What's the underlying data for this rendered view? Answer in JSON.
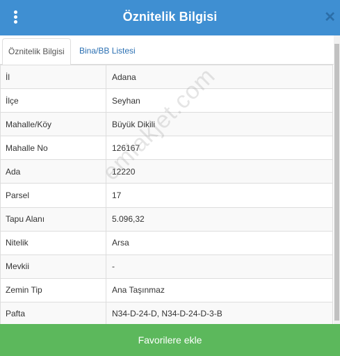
{
  "header": {
    "title": "Öznitelik Bilgisi"
  },
  "tabs": [
    {
      "label": "Öznitelik Bilgisi",
      "active": true
    },
    {
      "label": "Bina/BB Listesi",
      "active": false
    }
  ],
  "attributes": [
    {
      "key": "İl",
      "value": "Adana"
    },
    {
      "key": "İlçe",
      "value": "Seyhan"
    },
    {
      "key": "Mahalle/Köy",
      "value": "Büyük Dikili"
    },
    {
      "key": "Mahalle No",
      "value": "126167"
    },
    {
      "key": "Ada",
      "value": "12220"
    },
    {
      "key": "Parsel",
      "value": "17"
    },
    {
      "key": "Tapu Alanı",
      "value": "5.096,32"
    },
    {
      "key": "Nitelik",
      "value": "Arsa"
    },
    {
      "key": "Mevkii",
      "value": "-"
    },
    {
      "key": "Zemin Tip",
      "value": "Ana Taşınmaz"
    },
    {
      "key": "Pafta",
      "value": "N34-D-24-D, N34-D-24-D-3-B"
    }
  ],
  "watermark": "emlakjet.com",
  "footer": {
    "button_label": "Favorilere ekle"
  },
  "colors": {
    "header": "#3f8fd2",
    "button": "#5cb85c",
    "link": "#2a6fb2"
  }
}
